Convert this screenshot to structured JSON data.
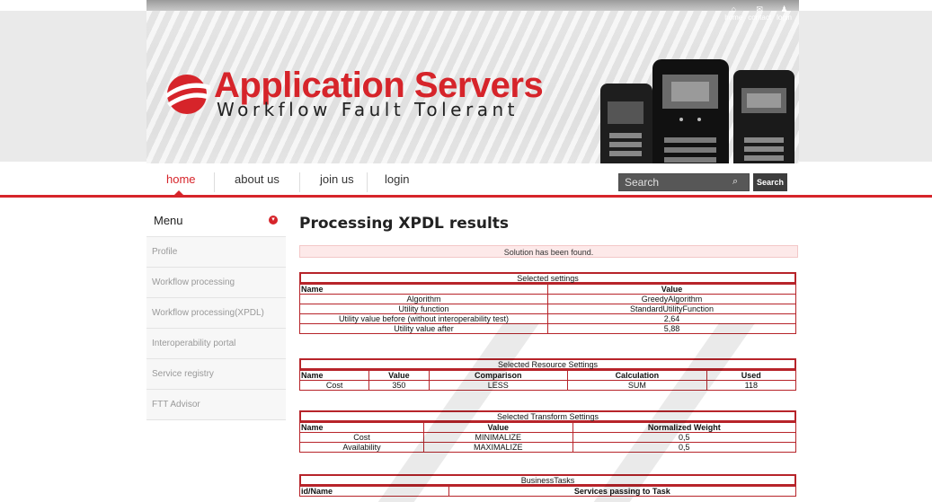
{
  "header": {
    "toplinks": [
      {
        "label": "home",
        "icon": "home-icon"
      },
      {
        "label": "contact",
        "icon": "mail-icon"
      },
      {
        "label": "login",
        "icon": "user-icon"
      }
    ],
    "logo_title": "Application Servers",
    "logo_subtitle": "Workflow Fault Tolerant",
    "brand_color": "#d6242a"
  },
  "nav": {
    "items": [
      "home",
      "about us",
      "join us",
      "login"
    ],
    "active": "home",
    "search_placeholder": "Search",
    "search_button": "Search"
  },
  "sidebar": {
    "title": "Menu",
    "items": [
      "Profile",
      "Workflow processing",
      "Workflow processing(XPDL)",
      "Interoperability portal",
      "Service registry",
      "FTT Advisor"
    ]
  },
  "main": {
    "title": "Processing XPDL results",
    "alert": "Solution has been found.",
    "settings": {
      "caption": "Selected settings",
      "headers": [
        "Name",
        "Value"
      ],
      "rows": [
        [
          "Algorithm",
          "GreedyAlgorithm"
        ],
        [
          "Utility function",
          "StandardUtilityFunction"
        ],
        [
          "Utility value before (without interoperability test)",
          "2,64"
        ],
        [
          "Utility value after",
          "5,88"
        ]
      ]
    },
    "resource": {
      "caption": "Selected Resource Settings",
      "headers": [
        "Name",
        "Value",
        "Comparison",
        "Calculation",
        "Used"
      ],
      "rows": [
        [
          "Cost",
          "350",
          "LESS",
          "SUM",
          "118"
        ]
      ]
    },
    "transform": {
      "caption": "Selected Transform Settings",
      "headers": [
        "Name",
        "Value",
        "Normalized Weight"
      ],
      "rows": [
        [
          "Cost",
          "MINIMALIZE",
          "0,5"
        ],
        [
          "Availability",
          "MAXIMALIZE",
          "0,5"
        ]
      ]
    },
    "tasks": {
      "caption": "BusinessTasks",
      "headers": [
        "id/Name",
        "Services passing to Task"
      ]
    }
  }
}
